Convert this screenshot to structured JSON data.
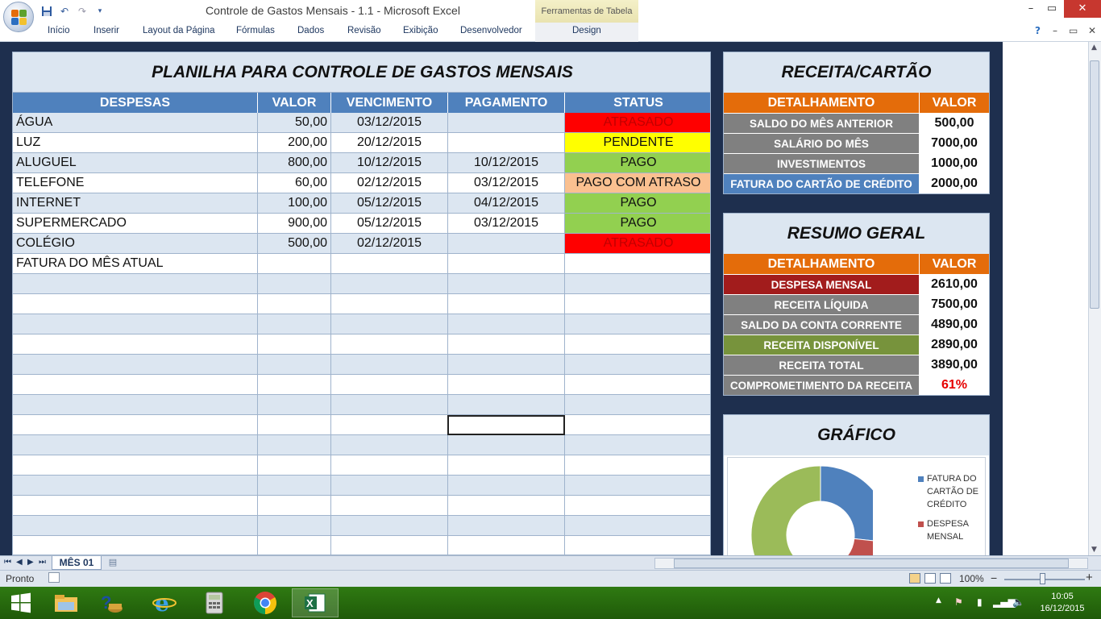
{
  "window": {
    "title": "Controle de Gastos Mensais - 1.1 - Microsoft Excel",
    "tool_tab": "Ferramentas de Tabela",
    "controls": {
      "minimize": "–",
      "restore": "▭",
      "close": "✕"
    }
  },
  "ribbon": {
    "tabs": [
      "Início",
      "Inserir",
      "Layout da Página",
      "Fórmulas",
      "Dados",
      "Revisão",
      "Exibição",
      "Desenvolvedor",
      "Design"
    ],
    "help": "?",
    "controls": {
      "minimize": "–",
      "restore": "▭",
      "close": "✕"
    }
  },
  "main": {
    "title": "PLANILHA PARA CONTROLE DE GASTOS MENSAIS",
    "headers": [
      "DESPESAS",
      "VALOR",
      "VENCIMENTO",
      "PAGAMENTO",
      "STATUS"
    ],
    "rows": [
      {
        "despesa": "ÁGUA",
        "valor": "50,00",
        "vencimento": "03/12/2015",
        "pagamento": "",
        "status": "ATRASADO",
        "status_bg": "#ff0000",
        "status_color": "#c00000"
      },
      {
        "despesa": "LUZ",
        "valor": "200,00",
        "vencimento": "20/12/2015",
        "pagamento": "",
        "status": "PENDENTE",
        "status_bg": "#ffff00",
        "status_color": "#111111"
      },
      {
        "despesa": "ALUGUEL",
        "valor": "800,00",
        "vencimento": "10/12/2015",
        "pagamento": "10/12/2015",
        "status": "PAGO",
        "status_bg": "#92d050",
        "status_color": "#111111"
      },
      {
        "despesa": "TELEFONE",
        "valor": "60,00",
        "vencimento": "02/12/2015",
        "pagamento": "03/12/2015",
        "status": "PAGO COM ATRASO",
        "status_bg": "#fac090",
        "status_color": "#111111"
      },
      {
        "despesa": "INTERNET",
        "valor": "100,00",
        "vencimento": "05/12/2015",
        "pagamento": "04/12/2015",
        "status": "PAGO",
        "status_bg": "#92d050",
        "status_color": "#111111"
      },
      {
        "despesa": "SUPERMERCADO",
        "valor": "900,00",
        "vencimento": "05/12/2015",
        "pagamento": "03/12/2015",
        "status": "PAGO",
        "status_bg": "#92d050",
        "status_color": "#111111"
      },
      {
        "despesa": "COLÉGIO",
        "valor": "500,00",
        "vencimento": "02/12/2015",
        "pagamento": "",
        "status": "ATRASADO",
        "status_bg": "#ff0000",
        "status_color": "#c00000"
      },
      {
        "despesa": "FATURA DO MÊS ATUAL",
        "valor": "",
        "vencimento": "",
        "pagamento": "",
        "status": "",
        "status_bg": "",
        "status_color": ""
      },
      {
        "despesa": "",
        "valor": "",
        "vencimento": "",
        "pagamento": "",
        "status": "",
        "status_bg": "",
        "status_color": ""
      },
      {
        "despesa": "",
        "valor": "",
        "vencimento": "",
        "pagamento": "",
        "status": "",
        "status_bg": "",
        "status_color": ""
      },
      {
        "despesa": "",
        "valor": "",
        "vencimento": "",
        "pagamento": "",
        "status": "",
        "status_bg": "",
        "status_color": ""
      },
      {
        "despesa": "",
        "valor": "",
        "vencimento": "",
        "pagamento": "",
        "status": "",
        "status_bg": "",
        "status_color": ""
      },
      {
        "despesa": "",
        "valor": "",
        "vencimento": "",
        "pagamento": "",
        "status": "",
        "status_bg": "",
        "status_color": ""
      },
      {
        "despesa": "",
        "valor": "",
        "vencimento": "",
        "pagamento": "",
        "status": "",
        "status_bg": "",
        "status_color": ""
      },
      {
        "despesa": "",
        "valor": "",
        "vencimento": "",
        "pagamento": "",
        "status": "",
        "status_bg": "",
        "status_color": ""
      },
      {
        "despesa": "",
        "valor": "",
        "vencimento": "",
        "pagamento": "",
        "status": "",
        "status_bg": "",
        "status_color": ""
      },
      {
        "despesa": "",
        "valor": "",
        "vencimento": "",
        "pagamento": "",
        "status": "",
        "status_bg": "",
        "status_color": ""
      },
      {
        "despesa": "",
        "valor": "",
        "vencimento": "",
        "pagamento": "",
        "status": "",
        "status_bg": "",
        "status_color": ""
      },
      {
        "despesa": "",
        "valor": "",
        "vencimento": "",
        "pagamento": "",
        "status": "",
        "status_bg": "",
        "status_color": ""
      },
      {
        "despesa": "",
        "valor": "",
        "vencimento": "",
        "pagamento": "",
        "status": "",
        "status_bg": "",
        "status_color": ""
      },
      {
        "despesa": "",
        "valor": "",
        "vencimento": "",
        "pagamento": "",
        "status": "",
        "status_bg": "",
        "status_color": ""
      },
      {
        "despesa": "",
        "valor": "",
        "vencimento": "",
        "pagamento": "",
        "status": "",
        "status_bg": "",
        "status_color": ""
      },
      {
        "despesa": "",
        "valor": "",
        "vencimento": "",
        "pagamento": "",
        "status": "",
        "status_bg": "",
        "status_color": ""
      }
    ]
  },
  "receita": {
    "title": "RECEITA/CARTÃO",
    "headers": [
      "DETALHAMENTO",
      "VALOR"
    ],
    "rows": [
      {
        "label": "SALDO DO MÊS ANTERIOR",
        "value": "500,00",
        "bg": "#808080",
        "color": "#111111"
      },
      {
        "label": "SALÁRIO DO MÊS",
        "value": "7000,00",
        "bg": "#808080",
        "color": "#111111"
      },
      {
        "label": "INVESTIMENTOS",
        "value": "1000,00",
        "bg": "#808080",
        "color": "#111111"
      },
      {
        "label": "FATURA DO CARTÃO DE CRÉDITO",
        "value": "2000,00",
        "bg": "#4f81bd",
        "color": "#111111"
      }
    ]
  },
  "resumo": {
    "title": "RESUMO GERAL",
    "headers": [
      "DETALHAMENTO",
      "VALOR"
    ],
    "rows": [
      {
        "label": "DESPESA MENSAL",
        "value": "2610,00",
        "bg": "#a21c1c",
        "color": "#111111"
      },
      {
        "label": "RECEITA LÍQUIDA",
        "value": "7500,00",
        "bg": "#808080",
        "color": "#111111"
      },
      {
        "label": "SALDO DA CONTA CORRENTE",
        "value": "4890,00",
        "bg": "#808080",
        "color": "#111111"
      },
      {
        "label": "RECEITA DISPONÍVEL",
        "value": "2890,00",
        "bg": "#77933c",
        "color": "#111111"
      },
      {
        "label": "RECEITA TOTAL",
        "value": "3890,00",
        "bg": "#808080",
        "color": "#111111"
      },
      {
        "label": "COMPROMETIMENTO DA RECEITA",
        "value": "61%",
        "bg": "#808080",
        "color": "#e60000"
      }
    ]
  },
  "grafico": {
    "title": "GRÁFICO",
    "legend": [
      {
        "label": "FATURA DO CARTÃO DE CRÉDITO",
        "lines": [
          "FATURA DO",
          "CARTÃO DE",
          "CRÉDITO"
        ],
        "color": "#4f81bd"
      },
      {
        "label": "DESPESA MENSAL",
        "lines": [
          "DESPESA",
          "MENSAL"
        ],
        "color": "#c0504d"
      }
    ]
  },
  "chart_data": {
    "type": "pie",
    "categories": [
      "FATURA DO CARTÃO DE CRÉDITO",
      "DESPESA MENSAL",
      "RECEITA DISPONÍVEL"
    ],
    "values": [
      2000,
      2610,
      2890
    ],
    "colors": [
      "#4f81bd",
      "#c0504d",
      "#9bbb59"
    ],
    "title": "GRÁFICO",
    "xlabel": "",
    "ylabel": "",
    "legend": "right"
  },
  "sheet_tabs": {
    "active": "MÊS 01"
  },
  "status": {
    "ready": "Pronto",
    "zoom": "100%",
    "zoom_minus": "−",
    "zoom_plus": "+"
  },
  "taskbar": {
    "time": "10:05",
    "date": "16/12/2015"
  }
}
